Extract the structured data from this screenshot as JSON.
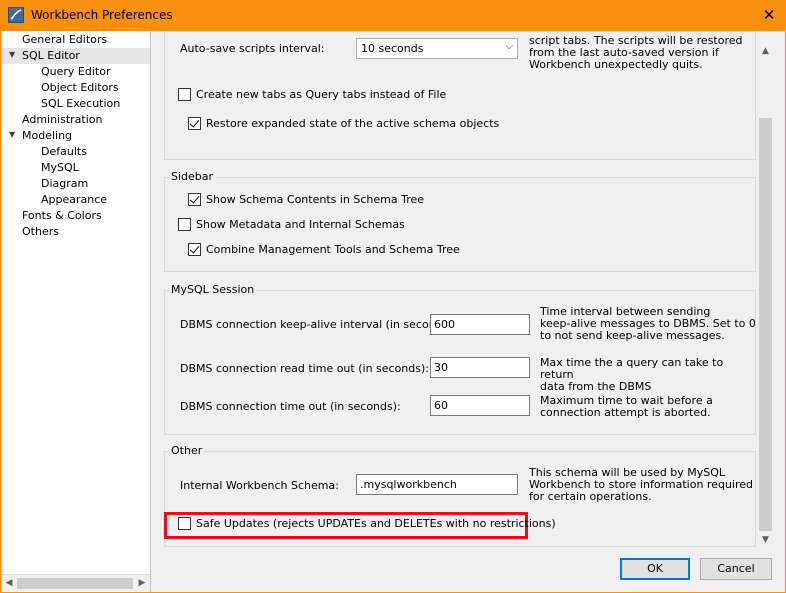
{
  "window": {
    "title": "Workbench Preferences"
  },
  "tree": [
    {
      "label": "General Editors",
      "level": 0
    },
    {
      "label": "SQL Editor",
      "level": 0,
      "expanded": true,
      "selected": true
    },
    {
      "label": "Query Editor",
      "level": 1
    },
    {
      "label": "Object Editors",
      "level": 1
    },
    {
      "label": "SQL Execution",
      "level": 1
    },
    {
      "label": "Administration",
      "level": 0
    },
    {
      "label": "Modeling",
      "level": 0,
      "expanded": true
    },
    {
      "label": "Defaults",
      "level": 1
    },
    {
      "label": "MySQL",
      "level": 1
    },
    {
      "label": "Diagram",
      "level": 1
    },
    {
      "label": "Appearance",
      "level": 1
    },
    {
      "label": "Fonts & Colors",
      "level": 0
    },
    {
      "label": "Others",
      "level": 0
    }
  ],
  "top": {
    "autosave_label": "Auto-save scripts interval:",
    "autosave_value": "10 seconds",
    "autosave_note_1": "script tabs. The scripts will be restored",
    "autosave_note_2": "from the last auto-saved version if",
    "autosave_note_3": "Workbench unexpectedly quits.",
    "new_tabs_label": "Create new tabs as Query tabs instead of File",
    "new_tabs_checked": false,
    "restore_label": "Restore expanded state of the active schema objects",
    "restore_checked": true
  },
  "sidebar": {
    "title": "Sidebar",
    "schema_contents_label": "Show Schema Contents in Schema Tree",
    "schema_contents_checked": true,
    "metadata_label": "Show Metadata and Internal Schemas",
    "metadata_checked": false,
    "combine_label": "Combine Management Tools and Schema Tree",
    "combine_checked": true
  },
  "session": {
    "title": "MySQL Session",
    "keepalive_label": "DBMS connection keep-alive interval (in seconds):",
    "keepalive_value": "600",
    "keepalive_note_1": "Time interval between sending",
    "keepalive_note_2": "keep-alive messages to DBMS. Set to 0",
    "keepalive_note_3": "to not send keep-alive messages.",
    "read_timeout_label": "DBMS connection read time out (in seconds):",
    "read_timeout_value": "30",
    "read_timeout_note_1": "Max time the a query can take to return",
    "read_timeout_note_2": "data from the DBMS",
    "conn_timeout_label": "DBMS connection time out (in seconds):",
    "conn_timeout_value": "60",
    "conn_timeout_note_1": "Maximum time to wait before a",
    "conn_timeout_note_2": "connection attempt is aborted."
  },
  "other": {
    "title": "Other",
    "schema_label": "Internal Workbench Schema:",
    "schema_value": ".mysqlworkbench",
    "schema_note_1": "This schema will be used by MySQL",
    "schema_note_2": "Workbench to store information required",
    "schema_note_3": "for certain operations.",
    "safe_updates_label": "Safe Updates (rejects UPDATEs and DELETEs with no restrictions)",
    "safe_updates_checked": false
  },
  "buttons": {
    "ok": "OK",
    "cancel": "Cancel"
  },
  "colors": {
    "titlebar": "#f88f0e",
    "highlight": "#e3121e",
    "default_button": "#0078d7"
  }
}
